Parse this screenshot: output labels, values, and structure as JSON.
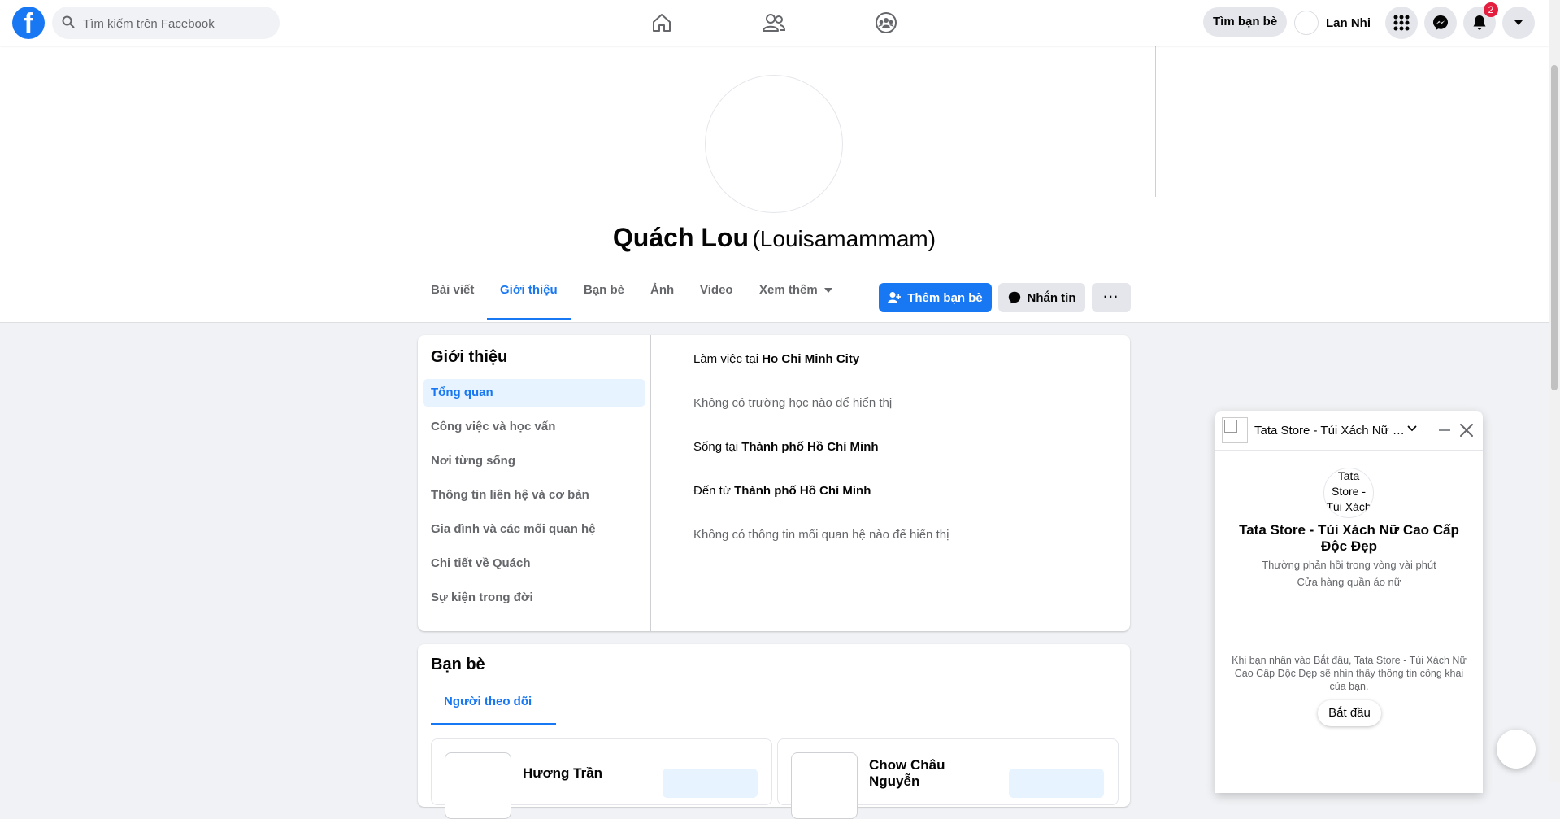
{
  "topbar": {
    "search_placeholder": "Tìm kiếm trên Facebook",
    "find_friends": "Tìm bạn bè",
    "user_name": "Lan Nhi",
    "notification_count": "2",
    "icons": [
      "facebook-logo",
      "search-icon",
      "home-icon",
      "friends-icon",
      "groups-icon",
      "menu-grid-icon",
      "messenger-icon",
      "bell-icon",
      "caret-down-icon"
    ]
  },
  "profile": {
    "name": "Quách Lou",
    "alternate_name": "(Louisamammam)",
    "tabs": [
      "Bài viết",
      "Giới thiệu",
      "Bạn bè",
      "Ảnh",
      "Video",
      "Xem thêm"
    ],
    "active_tab": "Giới thiệu",
    "add_friend": "Thêm bạn bè",
    "message": "Nhắn tin",
    "more": "···"
  },
  "about": {
    "title": "Giới thiệu",
    "nav": [
      "Tổng quan",
      "Công việc và học vấn",
      "Nơi từng sống",
      "Thông tin liên hệ và cơ bản",
      "Gia đình và các mối quan hệ",
      "Chi tiết về Quách",
      "Sự kiện trong đời"
    ],
    "active_nav": "Tổng quan",
    "rows": [
      {
        "prefix": "Làm việc tại ",
        "bold": "Ho Chi Minh City"
      },
      {
        "text": "Không có trường học nào để hiển thị"
      },
      {
        "prefix": "Sống tại ",
        "bold": "Thành phố Hồ Chí Minh"
      },
      {
        "prefix": "Đến từ ",
        "bold": "Thành phố Hồ Chí Minh"
      },
      {
        "text": "Không có thông tin mối quan hệ nào để hiển thị"
      }
    ]
  },
  "friends": {
    "title": "Bạn bè",
    "tab": "Người theo dõi",
    "items": [
      {
        "name": "Hương Trần"
      },
      {
        "name": "Chow Châu Nguyễn"
      }
    ]
  },
  "chat": {
    "title": "Tata Store - Túi Xách Nữ Cao Cấp Độc Đẹp",
    "avatar_alt": "Tata Store - Túi Xách",
    "name": "Tata Store - Túi Xách Nữ Cao Cấp Độc Đẹp",
    "response_time": "Thường phản hồi trong vòng vài phút",
    "category": "Cửa hàng quần áo nữ",
    "notice": "Khi bạn nhấn vào Bắt đầu, Tata Store - Túi Xách Nữ Cao Cấp Độc Đẹp sẽ nhìn thấy thông tin công khai của bạn.",
    "start": "Bắt đầu"
  },
  "colors": {
    "accent": "#1877f2",
    "badge": "#e41e3f",
    "page_bg": "#f0f2f5"
  }
}
